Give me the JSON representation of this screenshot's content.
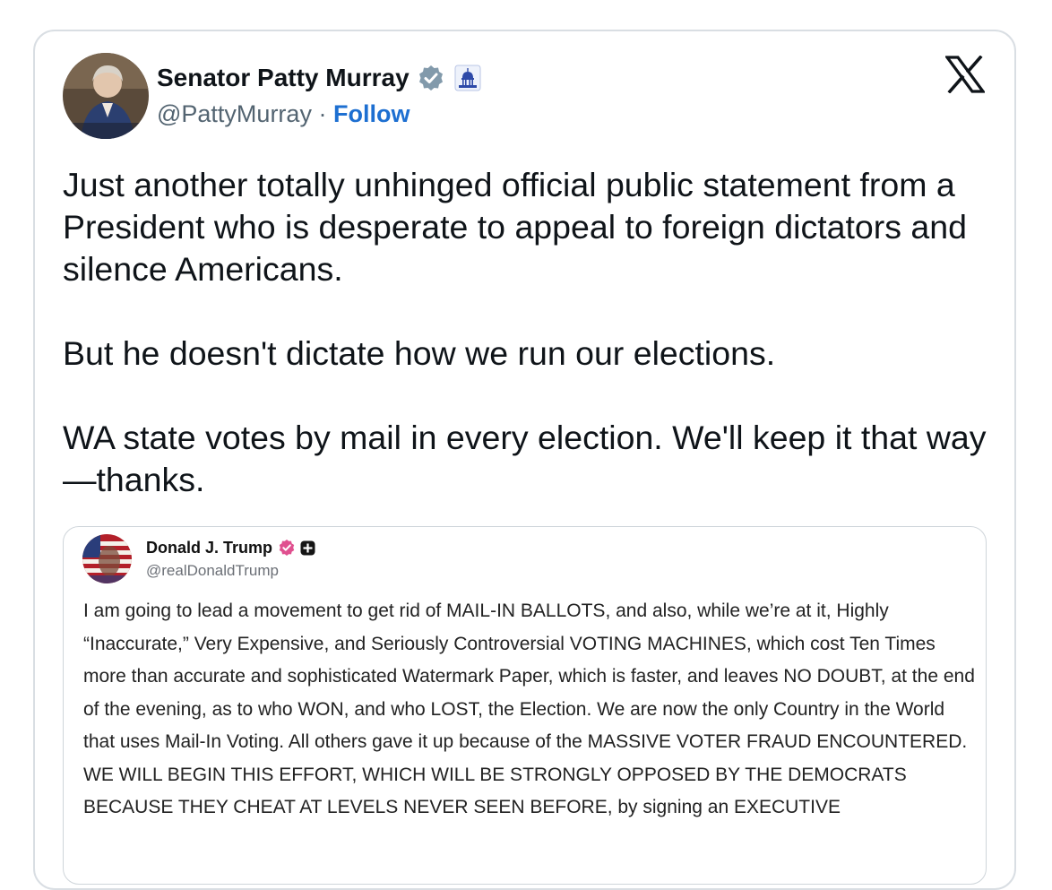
{
  "author": {
    "name": "Senator Patty Murray",
    "handle": "@PattyMurray",
    "separator": "·",
    "follow_label": "Follow",
    "verified_badge_color": "#829aab",
    "gov_badge_icon": "capitol-building-icon"
  },
  "platform": {
    "logo_icon": "x-logo-icon"
  },
  "tweet": {
    "paragraphs": [
      "Just another totally unhinged official public statement from a President who is desperate to appeal to foreign dictators and silence Americans.",
      "But he doesn't dictate how we run our elections.",
      "WA state votes by mail in every election. We'll keep it that way—thanks."
    ]
  },
  "quoted_post": {
    "name": "Donald J. Trump",
    "handle": "@realDonaldTrump",
    "verified_badge_color": "#e0508f",
    "text": "I am going to lead a movement to get rid of MAIL-IN BALLOTS, and also, while we’re at it, Highly “Inaccurate,” Very Expensive, and Seriously Controversial VOTING MACHINES, which cost Ten Times more than accurate and sophisticated Watermark Paper, which is faster, and leaves NO DOUBT, at the end of the evening, as to who WON, and who LOST, the Election. We are now the only Country in the World that uses Mail-In Voting. All others gave it up because of the MASSIVE VOTER FRAUD ENCOUNTERED. WE WILL BEGIN THIS EFFORT, WHICH WILL BE STRONGLY OPPOSED BY THE DEMOCRATS BECAUSE THEY CHEAT AT LEVELS NEVER SEEN BEFORE, by signing an EXECUTIVE"
  }
}
